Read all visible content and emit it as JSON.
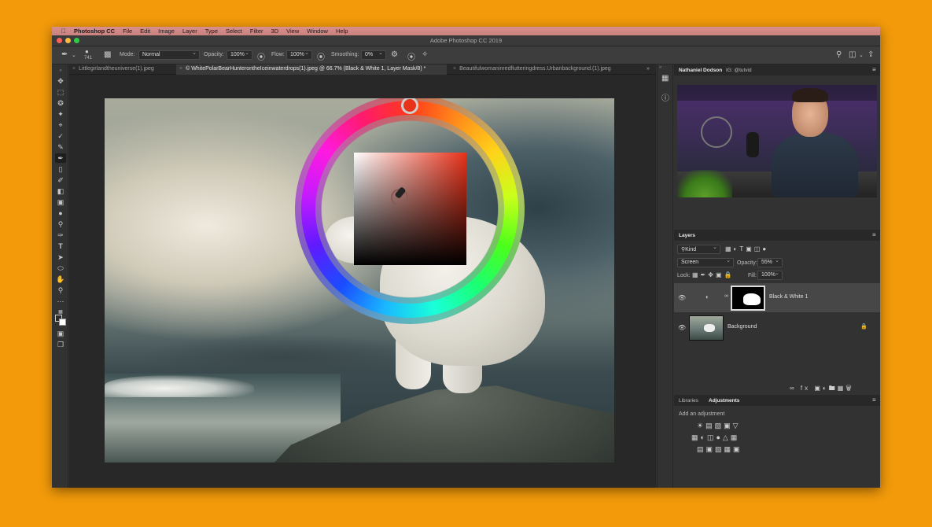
{
  "menubar": {
    "apple": "",
    "app_name": "Photoshop CC",
    "items": [
      "File",
      "Edit",
      "Image",
      "Layer",
      "Type",
      "Select",
      "Filter",
      "3D",
      "View",
      "Window",
      "Help"
    ]
  },
  "window": {
    "title": "Adobe Photoshop CC 2019",
    "traffic_colors": [
      "#fc605b",
      "#fdbc40",
      "#34c84a"
    ]
  },
  "options_bar": {
    "brush_size": "741",
    "mode_label": "Mode:",
    "mode_value": "Normal",
    "opacity_label": "Opacity:",
    "opacity_value": "100%",
    "flow_label": "Flow:",
    "flow_value": "100%",
    "smoothing_label": "Smoothing:",
    "smoothing_value": "0%"
  },
  "tabs": [
    {
      "label": "Littlegirlandtheuniverse(1).jpeg",
      "active": false
    },
    {
      "label": "© WhitePolarBearHunterontheIceinwaterdrops(1).jpeg @ 66.7% (Black & White 1, Layer Mask/8) *",
      "active": true
    },
    {
      "label": "Beautifulwomaninredflutteringdress.Urbanbackground.(1).jpeg",
      "active": false
    }
  ],
  "color_wheel": {
    "hue_color": "#e8321a"
  },
  "stream_panel": {
    "tabs": [
      "Nathaniel Dodson",
      "IG: @tutvid"
    ]
  },
  "layers_panel": {
    "title": "Layers",
    "filter_kind": "Kind",
    "blend_mode": "Screen",
    "opacity_label": "Opacity:",
    "opacity_value": "55%",
    "lock_label": "Lock:",
    "fill_label": "Fill:",
    "fill_value": "100%",
    "layers": [
      {
        "name": "Black & White 1",
        "selected": true
      },
      {
        "name": "Background",
        "selected": false
      }
    ]
  },
  "adjustments_panel": {
    "tabs": [
      "Libraries",
      "Adjustments"
    ],
    "subtitle": "Add an adjustment"
  }
}
